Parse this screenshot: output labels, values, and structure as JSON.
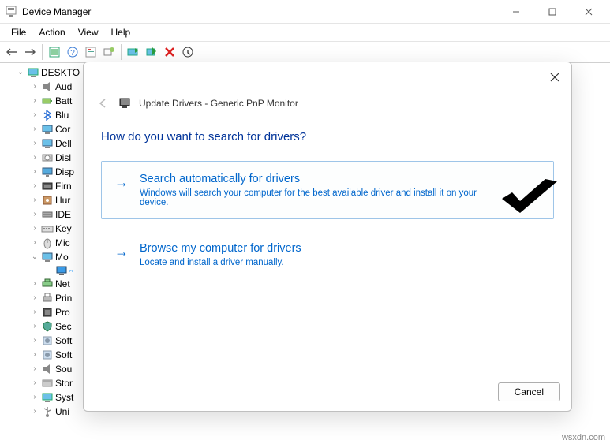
{
  "window": {
    "title": "Device Manager"
  },
  "menus": [
    "File",
    "Action",
    "View",
    "Help"
  ],
  "tree": {
    "root": "DESKTO",
    "items": [
      {
        "label": "Aud",
        "icon": "speaker"
      },
      {
        "label": "Batt",
        "icon": "battery"
      },
      {
        "label": "Blu",
        "icon": "bluetooth"
      },
      {
        "label": "Cor",
        "icon": "monitor"
      },
      {
        "label": "Dell",
        "icon": "monitor"
      },
      {
        "label": "Disl",
        "icon": "disk"
      },
      {
        "label": "Disp",
        "icon": "display"
      },
      {
        "label": "Firn",
        "icon": "firmware"
      },
      {
        "label": "Hur",
        "icon": "hid"
      },
      {
        "label": "IDE",
        "icon": "ide"
      },
      {
        "label": "Key",
        "icon": "keyboard"
      },
      {
        "label": "Mic",
        "icon": "mouse"
      },
      {
        "label": "Mo",
        "icon": "monitor",
        "expanded": true,
        "children": [
          {
            "label": "",
            "icon": "monitor-blue",
            "selected": true
          }
        ]
      },
      {
        "label": "Net",
        "icon": "network"
      },
      {
        "label": "Prin",
        "icon": "printer"
      },
      {
        "label": "Pro",
        "icon": "cpu"
      },
      {
        "label": "Sec",
        "icon": "security"
      },
      {
        "label": "Soft",
        "icon": "soft"
      },
      {
        "label": "Soft",
        "icon": "soft"
      },
      {
        "label": "Sou",
        "icon": "speaker"
      },
      {
        "label": "Stor",
        "icon": "storage"
      },
      {
        "label": "Syst",
        "icon": "computer"
      },
      {
        "label": "Uni",
        "icon": "usb"
      }
    ]
  },
  "dialog": {
    "title": "Update Drivers - Generic PnP Monitor",
    "question": "How do you want to search for drivers?",
    "option1": {
      "title": "Search automatically for drivers",
      "desc": "Windows will search your computer for the best available driver and install it on your device."
    },
    "option2": {
      "title": "Browse my computer for drivers",
      "desc": "Locate and install a driver manually."
    },
    "cancel": "Cancel"
  },
  "watermark": "wsxdn.com"
}
